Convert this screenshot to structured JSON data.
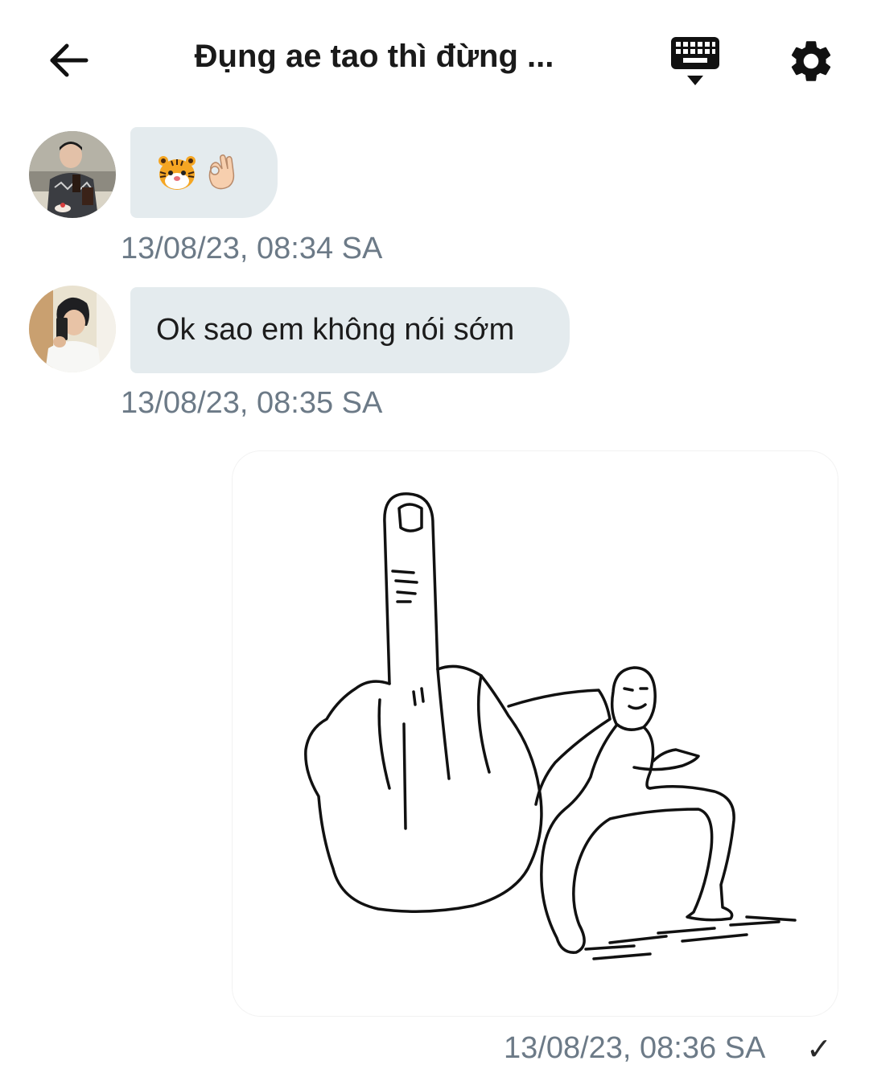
{
  "header": {
    "title": "Đụng ae tao thì đừng ...",
    "back_icon": "arrow-left-icon",
    "keyboard_icon": "keyboard-hide-icon",
    "settings_icon": "gear-icon"
  },
  "messages": [
    {
      "sender": "other",
      "avatar_icon": "avatar-photo",
      "content_type": "emoji",
      "emojis": [
        "tiger-face-emoji",
        "ok-hand-emoji"
      ],
      "timestamp": "13/08/23, 08:34 SA"
    },
    {
      "sender": "other",
      "avatar_icon": "avatar-photo",
      "content_type": "text",
      "text": "Ok sao em không nói sớm",
      "timestamp": "13/08/23, 08:35 SA"
    },
    {
      "sender": "me",
      "content_type": "sticker",
      "sticker_icon": "middle-finger-sticker",
      "timestamp": "13/08/23, 08:36 SA",
      "status": "✓"
    }
  ],
  "colors": {
    "bubble": "#e4ebee",
    "timestamp": "#6c7a87",
    "title": "#1a1a1a"
  }
}
